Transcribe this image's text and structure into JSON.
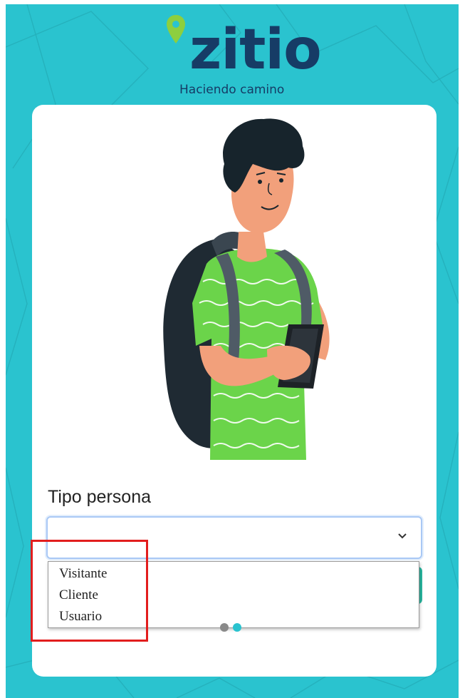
{
  "brand": {
    "logo_text": "zitio",
    "tagline": "Haciendo camino",
    "primary_color": "#2ac3cf",
    "logo_color": "#163c66",
    "pin_color": "#8dcf3f"
  },
  "illustration": {
    "icon": "person-with-backpack-and-phone-illustration"
  },
  "form": {
    "field_label": "Tipo persona",
    "select_value": "",
    "select_icon": "chevron-down-icon",
    "options": [
      "Visitante",
      "Cliente",
      "Usuario"
    ]
  },
  "pagination": {
    "total": 2,
    "active": 2
  },
  "annotation": {
    "highlight_color": "#e21d1d"
  }
}
